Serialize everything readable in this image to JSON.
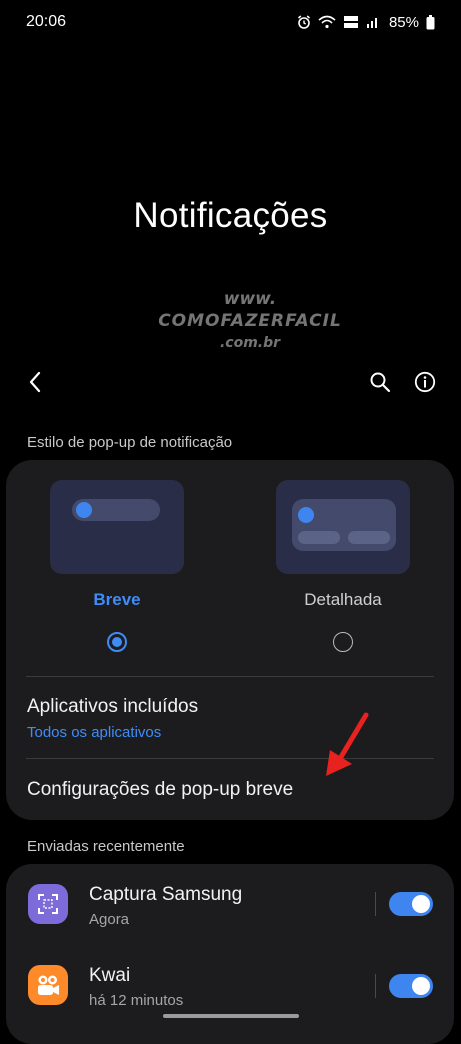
{
  "status_bar": {
    "time": "20:06",
    "battery": "85%",
    "icons": [
      "alarm-icon",
      "wifi-icon",
      "volte-icon",
      "signal-icon",
      "battery-icon"
    ]
  },
  "page_title": "Notificações",
  "watermark": {
    "line1": "www.",
    "line2": "COMOFAZERFACIL",
    "line3": ".com.br"
  },
  "toolbar": {
    "icons": [
      "back-icon",
      "search-icon",
      "info-icon"
    ]
  },
  "popup_style": {
    "section_label": "Estilo de pop-up de notificação",
    "options": [
      {
        "label": "Breve",
        "selected": true
      },
      {
        "label": "Detalhada",
        "selected": false
      }
    ],
    "included_apps_title": "Aplicativos incluídos",
    "included_apps_value": "Todos os aplicativos",
    "brief_settings_title": "Configurações de pop-up breve"
  },
  "recent": {
    "section_label": "Enviadas recentemente",
    "apps": [
      {
        "name": "Captura Samsung",
        "time": "Agora",
        "enabled": true
      },
      {
        "name": "Kwai",
        "time": "há 12 minutos",
        "enabled": true
      }
    ]
  },
  "colors": {
    "accent": "#3f85f0",
    "card_bg": "#1c1c1e",
    "arrow": "#e8231f"
  }
}
